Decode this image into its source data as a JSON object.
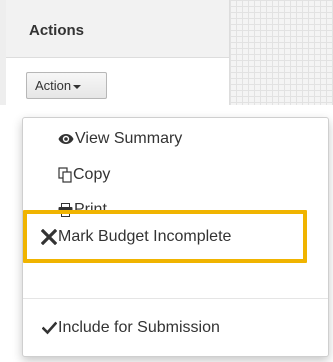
{
  "table": {
    "header_label": "Actions"
  },
  "action_button": {
    "label": "Action"
  },
  "menu": {
    "items": [
      {
        "label": "View Summary",
        "icon": "eye-icon"
      },
      {
        "label": "Copy",
        "icon": "copy-icon"
      },
      {
        "label": "Print",
        "icon": "print-icon"
      },
      {
        "label": "Mark Budget Incomplete",
        "icon": "x-icon"
      },
      {
        "label": "Include for Submission",
        "icon": "check-icon"
      }
    ]
  },
  "colors": {
    "highlight": "#f0b400",
    "text": "#333333"
  }
}
